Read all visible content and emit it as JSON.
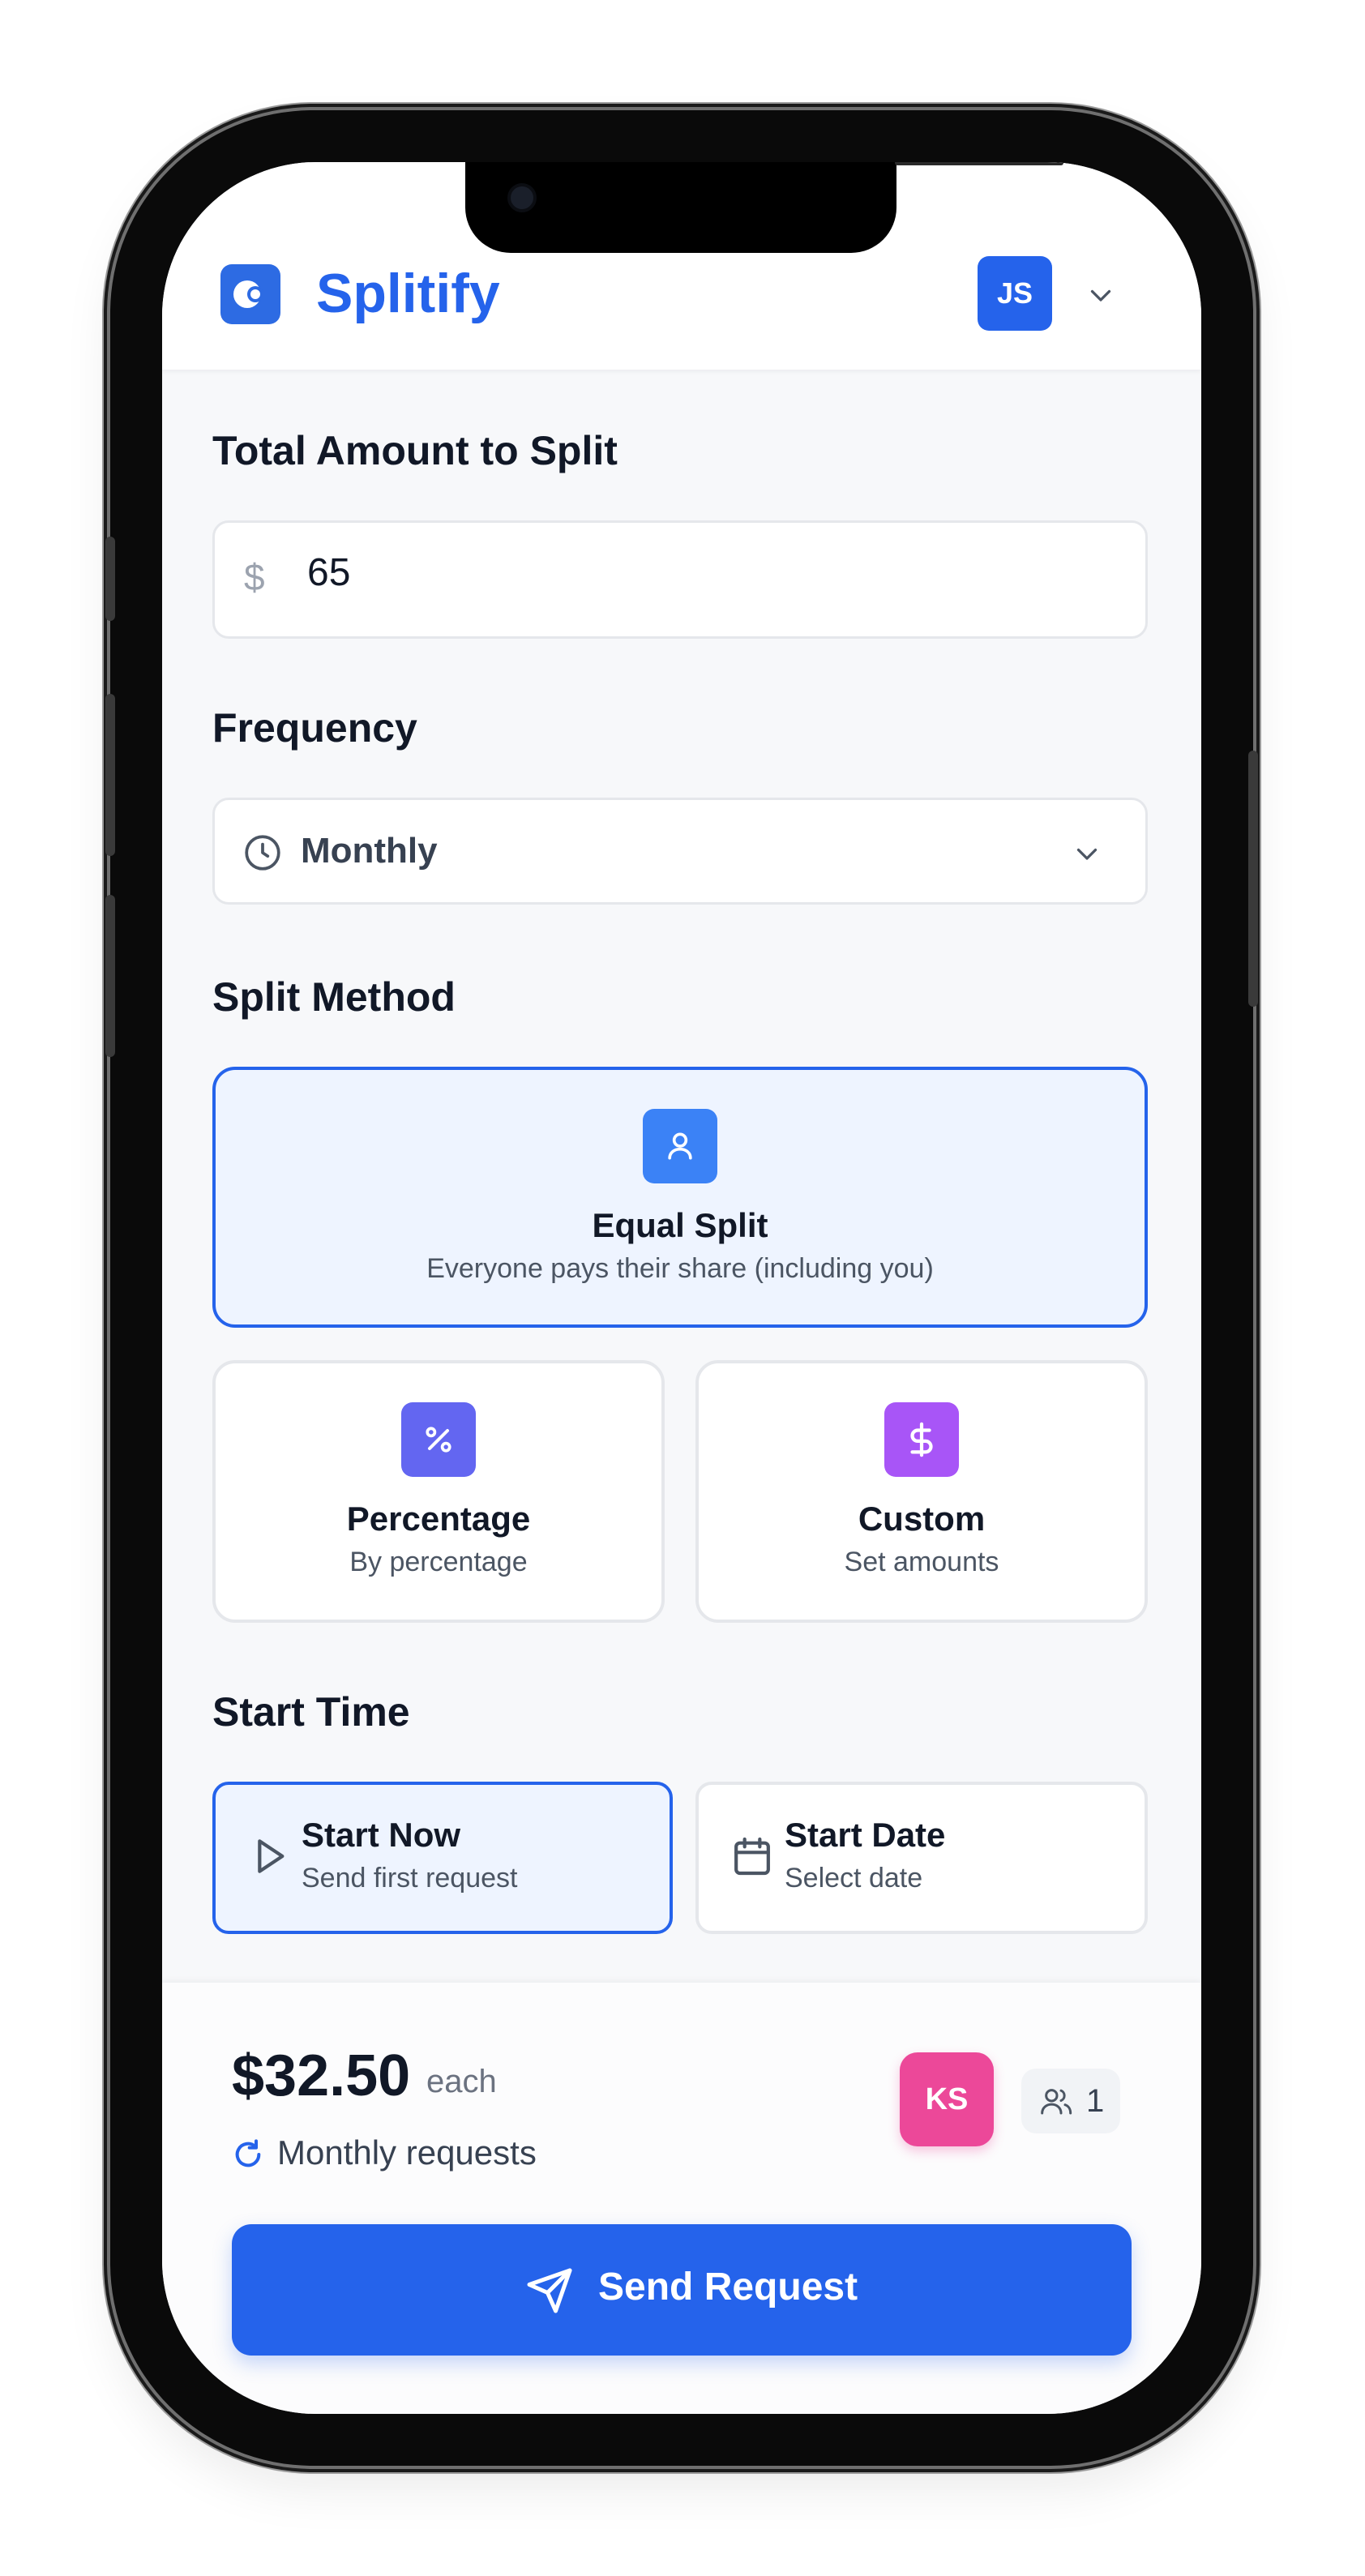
{
  "header": {
    "brand": "Splitify",
    "user_initials": "JS"
  },
  "amount": {
    "label": "Total Amount to Split",
    "currency_symbol": "$",
    "value": "65"
  },
  "frequency": {
    "label": "Frequency",
    "selected": "Monthly"
  },
  "split_method": {
    "label": "Split Method",
    "options": [
      {
        "title": "Equal Split",
        "subtitle": "Everyone pays their share (including you)",
        "icon": "user-icon",
        "selected": true
      },
      {
        "title": "Percentage",
        "subtitle": "By percentage",
        "icon": "percent-icon",
        "selected": false
      },
      {
        "title": "Custom",
        "subtitle": "Set amounts",
        "icon": "dollar-icon",
        "selected": false
      }
    ]
  },
  "start_time": {
    "label": "Start Time",
    "options": [
      {
        "title": "Start Now",
        "subtitle": "Send first request",
        "icon": "play-icon",
        "selected": true
      },
      {
        "title": "Start Date",
        "subtitle": "Select date",
        "icon": "calendar-icon",
        "selected": false
      }
    ]
  },
  "summary": {
    "per_person_amount": "$32.50",
    "per_label": "each",
    "recurrence_text": "Monthly requests",
    "participant_initials": "KS",
    "member_count": "1",
    "send_label": "Send Request"
  },
  "colors": {
    "primary": "#2563eb",
    "equal_icon": "#3b82f6",
    "percent_icon": "#6366f1",
    "custom_icon": "#a855f7",
    "participant": "#ec4899"
  }
}
